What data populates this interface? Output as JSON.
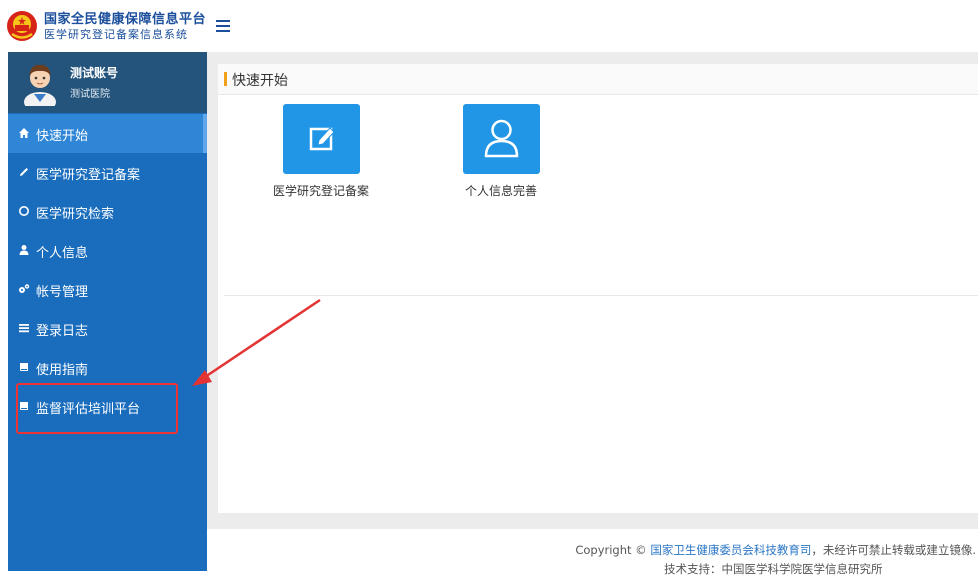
{
  "header": {
    "title": "国家全民健康保障信息平台",
    "subtitle": "医学研究登记备案信息系统"
  },
  "user": {
    "name": "测试账号",
    "org": "测试医院"
  },
  "sidebar": {
    "items": [
      {
        "label": "快速开始",
        "icon": "home-icon"
      },
      {
        "label": "医学研究登记备案",
        "icon": "pencil-icon"
      },
      {
        "label": "医学研究检索",
        "icon": "circle-icon"
      },
      {
        "label": "个人信息",
        "icon": "user-icon"
      },
      {
        "label": "帐号管理",
        "icon": "gears-icon"
      },
      {
        "label": "登录日志",
        "icon": "list-icon"
      },
      {
        "label": "使用指南",
        "icon": "book-icon"
      },
      {
        "label": "监督评估培训平台",
        "icon": "book-icon"
      }
    ]
  },
  "main": {
    "panel_title": "快速开始",
    "tiles": [
      {
        "label": "医学研究登记备案",
        "icon": "edit-icon"
      },
      {
        "label": "个人信息完善",
        "icon": "user-outline-icon"
      }
    ]
  },
  "footer": {
    "copyright_prefix": "Copyright ©",
    "org_link": "国家卫生健康委员会科技教育司",
    "copyright_suffix": "，未经许可禁止转载或建立镜像.",
    "support": "技术支持：中国医学科学院医学信息研究所"
  },
  "colors": {
    "sidebar": "#1a6dbd",
    "active": "#2f86d6",
    "tile": "#2196e6",
    "accent": "#f0a01a",
    "annotation": "#e33333"
  }
}
